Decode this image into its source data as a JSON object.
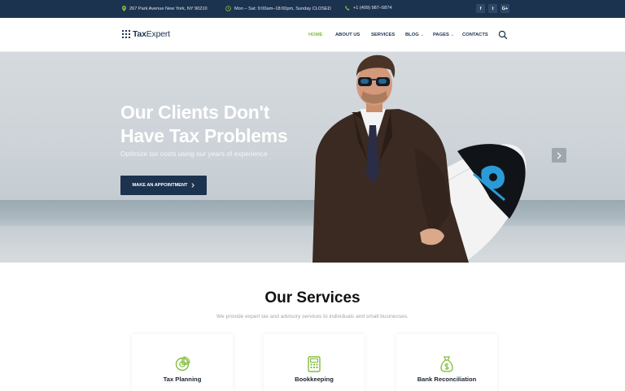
{
  "topbar": {
    "address": "267 Park Avenue New York, NY 90210",
    "hours": "Mon – Sat: 9:00am–18:00pm, Sunday CLOSED",
    "phone": "+1 (409) 987–5874",
    "social": [
      "f",
      "t",
      "G+"
    ]
  },
  "header": {
    "logo_strong": "Tax",
    "logo_light": "Expert",
    "nav": [
      {
        "label": "HOME"
      },
      {
        "label": "ABOUT US"
      },
      {
        "label": "SERVICES"
      },
      {
        "label": "BLOG"
      },
      {
        "label": "PAGES"
      },
      {
        "label": "CONTACTS"
      }
    ]
  },
  "hero": {
    "title_line1": "Our Clients Don't",
    "title_line2": "Have Tax Problems",
    "subtitle": "Optimize tax costs using our years of experience",
    "button_label": "MAKE AN APPOINTMENT"
  },
  "services": {
    "title": "Our Services",
    "subtitle": "We provide expert tax and advisory services to individuals and small businesses.",
    "cards": [
      {
        "label": "Tax Planning",
        "icon": "pie-chart-icon"
      },
      {
        "label": "Bookkeeping",
        "icon": "calculator-icon"
      },
      {
        "label": "Bank Reconciliation",
        "icon": "money-bag-icon"
      }
    ]
  },
  "colors": {
    "navy": "#1c3350",
    "accent_green": "#82bd3c"
  }
}
